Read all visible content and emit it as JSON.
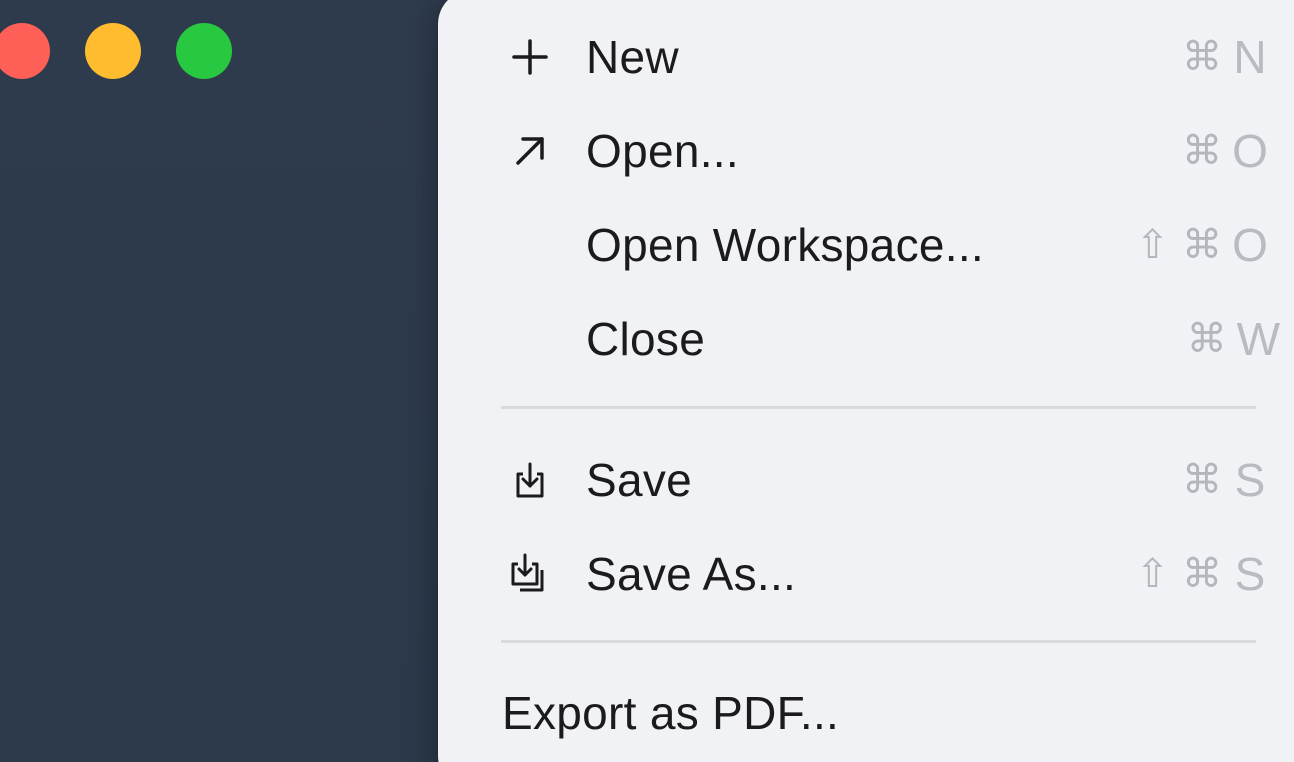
{
  "window": {
    "traffic_lights": {
      "close": {
        "color": "#fe5f57"
      },
      "minimize": {
        "color": "#febc2e"
      },
      "zoom": {
        "color": "#28c840"
      }
    }
  },
  "menu": {
    "items": [
      {
        "label": "New",
        "icon": "plus-icon",
        "shortcut_mods": "⌘",
        "shortcut_key": "N"
      },
      {
        "label": "Open...",
        "icon": "arrow-up-right-icon",
        "shortcut_mods": "⌘",
        "shortcut_key": "O"
      },
      {
        "label": "Open Workspace...",
        "icon": "",
        "shortcut_mods": "⇧ ⌘",
        "shortcut_key": "O"
      },
      {
        "label": "Close",
        "icon": "",
        "shortcut_mods": "⌘",
        "shortcut_key": "W"
      },
      {
        "label": "Save",
        "icon": "save-icon",
        "shortcut_mods": "⌘",
        "shortcut_key": "S"
      },
      {
        "label": "Save As...",
        "icon": "save-as-icon",
        "shortcut_mods": "⇧ ⌘",
        "shortcut_key": "S"
      },
      {
        "label": "Export as PDF...",
        "icon": "",
        "shortcut_mods": "",
        "shortcut_key": ""
      }
    ],
    "colors": {
      "background": "#f1f2f5",
      "text": "#1b1b1d",
      "shortcut": "#b4b6bb",
      "divider": "#d9dadd"
    }
  }
}
